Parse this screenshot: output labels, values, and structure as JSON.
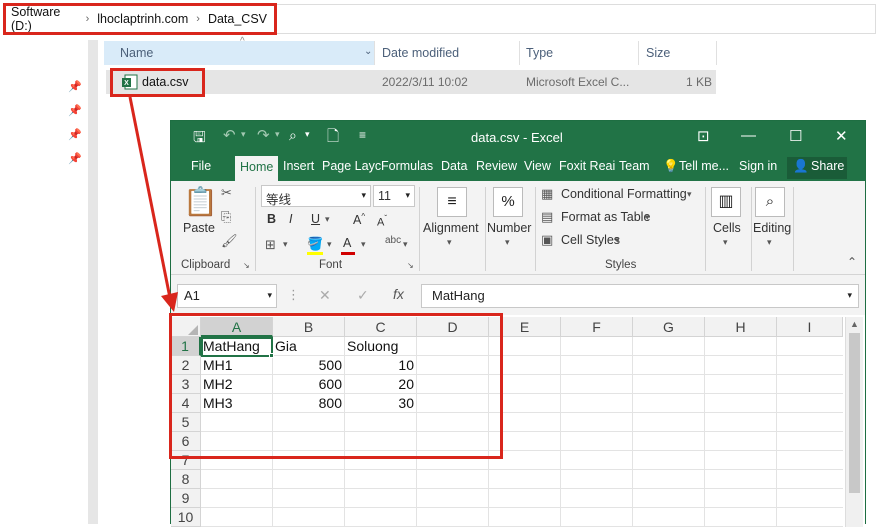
{
  "explorer": {
    "breadcrumb": [
      "Software (D:)",
      "lhoclaptrinh.com",
      "Data_CSV"
    ],
    "columns": {
      "name": "Name",
      "date_modified": "Date modified",
      "type": "Type",
      "size": "Size"
    },
    "file": {
      "name": "data.csv",
      "date": "2022/3/11 10:02",
      "type": "Microsoft Excel C...",
      "size": "1 KB"
    }
  },
  "excel": {
    "title": "data.csv - Excel",
    "tabs": [
      "File",
      "Home",
      "Insert",
      "Page Layc",
      "Formulas",
      "Data",
      "Review",
      "View",
      "Foxit Reai",
      "Team",
      "Tell me...",
      "Sign in",
      "Share"
    ],
    "active_tab": "Home",
    "ribbon": {
      "paste": "Paste",
      "clipboard": "Clipboard",
      "font_name": "等线",
      "font_size": "11",
      "font": "Font",
      "alignment": "Alignment",
      "number": "Number",
      "percent": "%",
      "conditional_formatting": "Conditional Formatting",
      "format_as_table": "Format as Table",
      "cell_styles": "Cell Styles",
      "styles": "Styles",
      "cells": "Cells",
      "editing": "Editing",
      "bold": "B",
      "italic": "I",
      "underline": "U"
    },
    "name_box": "A1",
    "formula": "MatHang",
    "fx": "fx",
    "columns": [
      "A",
      "B",
      "C",
      "D",
      "E",
      "F",
      "G",
      "H",
      "I"
    ],
    "rows": [
      "1",
      "2",
      "3",
      "4",
      "5",
      "6",
      "7",
      "8",
      "9",
      "10"
    ],
    "cells": [
      [
        "MatHang",
        "Gia",
        "Soluong"
      ],
      [
        "MH1",
        "500",
        "10"
      ],
      [
        "MH2",
        "600",
        "20"
      ],
      [
        "MH3",
        "800",
        "30"
      ]
    ]
  },
  "colors": {
    "excel_green": "#217346",
    "highlight_red": "#d9261c",
    "selection_blue": "#d9ebf9"
  }
}
